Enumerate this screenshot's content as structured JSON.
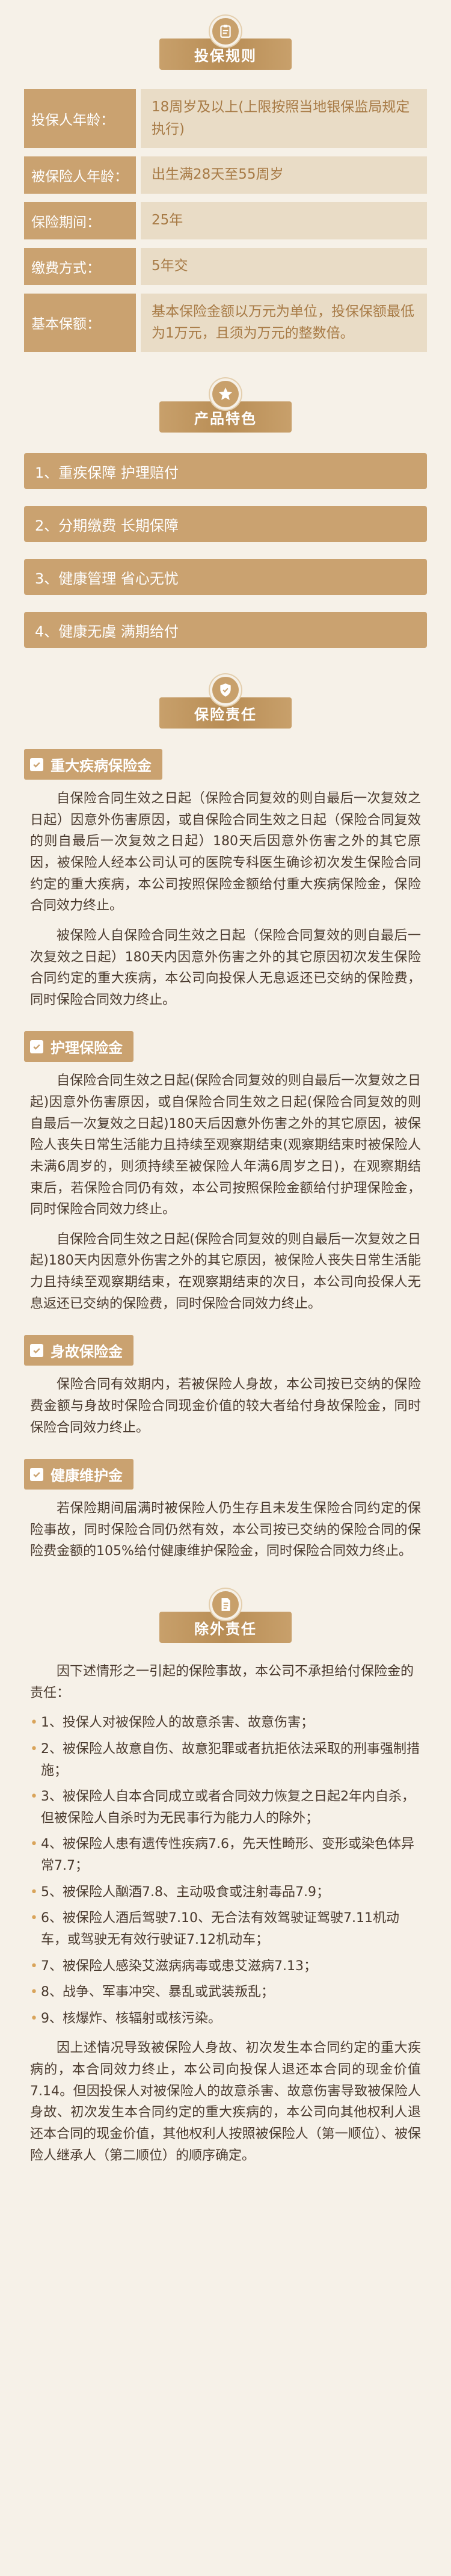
{
  "rules_section": {
    "title": "投保规则",
    "rows": [
      {
        "label": "投保人年龄：",
        "value": "18周岁及以上(上限按照当地银保监局规定执行)"
      },
      {
        "label": "被保险人年龄：",
        "value": "出生满28天至55周岁"
      },
      {
        "label": "保险期间：",
        "value": "25年"
      },
      {
        "label": "缴费方式：",
        "value": "5年交"
      },
      {
        "label": "基本保额：",
        "value": "基本保险金额以万元为单位，投保保额最低为1万元，且须为万元的整数倍。"
      }
    ]
  },
  "features_section": {
    "title": "产品特色",
    "items": [
      "1、重疾保障  护理赔付",
      "2、分期缴费  长期保障",
      "3、健康管理  省心无忧",
      "4、健康无虞  满期给付"
    ]
  },
  "liability_section": {
    "title": "保险责任",
    "blocks": [
      {
        "title": "重大疾病保险金",
        "paragraphs": [
          "自保险合同生效之日起（保险合同复效的则自最后一次复效之日起）因意外伤害原因，或自保险合同生效之日起（保险合同复效的则自最后一次复效之日起）180天后因意外伤害之外的其它原因，被保险人经本公司认可的医院专科医生确诊初次发生保险合同约定的重大疾病，本公司按照保险金额给付重大疾病保险金，保险合同效力终止。",
          "被保险人自保险合同生效之日起（保险合同复效的则自最后一次复效之日起）180天内因意外伤害之外的其它原因初次发生保险合同约定的重大疾病，本公司向投保人无息返还已交纳的保险费，同时保险合同效力终止。"
        ]
      },
      {
        "title": "护理保险金",
        "paragraphs": [
          "自保险合同生效之日起(保险合同复效的则自最后一次复效之日起)因意外伤害原因，或自保险合同生效之日起(保险合同复效的则自最后一次复效之日起)180天后因意外伤害之外的其它原因，被保险人丧失日常生活能力且持续至观察期结束(观察期结束时被保险人未满6周岁的，则须持续至被保险人年满6周岁之日)，在观察期结束后，若保险合同仍有效，本公司按照保险金额给付护理保险金，同时保险合同效力终止。",
          "自保险合同生效之日起(保险合同复效的则自最后一次复效之日起)180天内因意外伤害之外的其它原因，被保险人丧失日常生活能力且持续至观察期结束，在观察期结束的次日，本公司向投保人无息返还已交纳的保险费，同时保险合同效力终止。"
        ]
      },
      {
        "title": "身故保险金",
        "paragraphs": [
          "保险合同有效期内，若被保险人身故，本公司按已交纳的保险费金额与身故时保险合同现金价值的较大者给付身故保险金，同时保险合同效力终止。"
        ]
      },
      {
        "title": "健康维护金",
        "paragraphs": [
          "若保险期间届满时被保险人仍生存且未发生保险合同约定的保险事故，同时保险合同仍然有效，本公司按已交纳的保险合同的保险费金额的105%给付健康维护保险金，同时保险合同效力终止。"
        ]
      }
    ]
  },
  "exclusions_section": {
    "title": "除外责任",
    "intro": "因下述情形之一引起的保险事故，本公司不承担给付保险金的责任：",
    "items": [
      "1、投保人对被保险人的故意杀害、故意伤害；",
      "2、被保险人故意自伤、故意犯罪或者抗拒依法采取的刑事强制措施；",
      "3、被保险人自本合同成立或者合同效力恢复之日起2年内自杀，但被保险人自杀时为无民事行为能力人的除外；",
      "4、被保险人患有遗传性疾病7.6，先天性畸形、变形或染色体异常7.7；",
      "5、被保险人酗酒7.8、主动吸食或注射毒品7.9；",
      "6、被保险人酒后驾驶7.10、无合法有效驾驶证驾驶7.11机动车，或驾驶无有效行驶证7.12机动车；",
      "7、被保险人感染艾滋病病毒或患艾滋病7.13；",
      "8、战争、军事冲突、暴乱或武装叛乱；",
      "9、核爆炸、核辐射或核污染。"
    ],
    "closing": "因上述情况导致被保险人身故、初次发生本合同约定的重大疾病的，本合同效力终止，本公司向投保人退还本合同的现金价值7.14。但因投保人对被保险人的故意杀害、故意伤害导致被保险人身故、初次发生本合同约定的重大疾病的，本公司向其他权利人退还本合同的现金价值，其他权利人按照被保险人（第一顺位）、被保险人继承人（第二顺位）的顺序确定。"
  },
  "colors": {
    "accent": "#caa270",
    "value_bg": "#e9dcc6",
    "value_text": "#a77a45",
    "background": "#f6f1e8"
  }
}
